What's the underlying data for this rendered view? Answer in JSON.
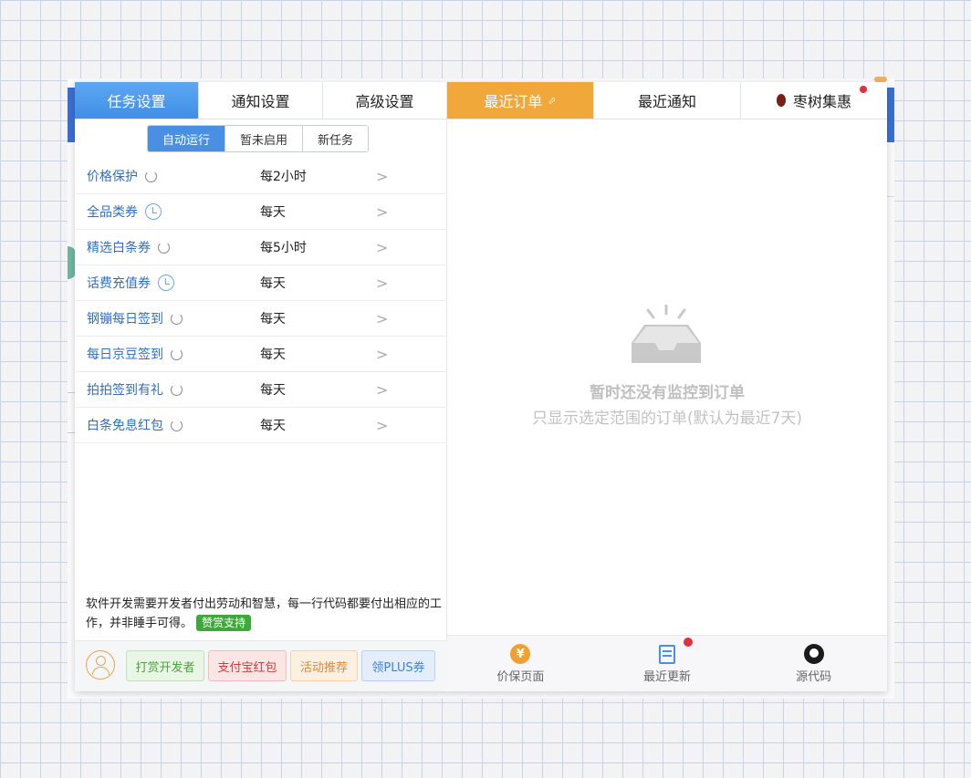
{
  "tabs_left": [
    {
      "label": "任务设置",
      "active": true
    },
    {
      "label": "通知设置",
      "active": false
    },
    {
      "label": "高级设置",
      "active": false
    }
  ],
  "tabs_right": [
    {
      "label": "最近订单",
      "active": true,
      "icon": "external-link-icon"
    },
    {
      "label": "最近通知",
      "active": false
    },
    {
      "label": "枣树集惠",
      "active": false,
      "icon": "jujube-icon"
    }
  ],
  "segments": [
    {
      "label": "自动运行",
      "active": true
    },
    {
      "label": "暂未启用",
      "active": false
    },
    {
      "label": "新任务",
      "active": false
    }
  ],
  "tasks": [
    {
      "name": "价格保护",
      "icon": "refresh-icon",
      "freq": "每2小时"
    },
    {
      "name": "全品类券",
      "icon": "clock-icon",
      "freq": "每天"
    },
    {
      "name": "精选白条券",
      "icon": "refresh-icon",
      "freq": "每5小时"
    },
    {
      "name": "话费充值券",
      "icon": "clock-icon",
      "freq": "每天"
    },
    {
      "name": "钢镚每日签到",
      "icon": "refresh-icon",
      "freq": "每天"
    },
    {
      "name": "每日京豆签到",
      "icon": "refresh-icon",
      "freq": "每天"
    },
    {
      "name": "拍拍签到有礼",
      "icon": "refresh-icon",
      "freq": "每天"
    },
    {
      "name": "白条免息红包",
      "icon": "refresh-icon",
      "freq": "每天"
    }
  ],
  "note": {
    "text": "软件开发需要开发者付出劳动和智慧，每一行代码都要付出相应的工作，并非睡手可得。",
    "button": "赞赏支持"
  },
  "bottom_left_buttons": [
    "打赏开发者",
    "支付宝红包",
    "活动推荐",
    "领PLUS券"
  ],
  "empty": {
    "title": "暂时还没有监控到订单",
    "subtitle": "只显示选定范围的订单(默认为最近7天)"
  },
  "bottom_nav": [
    {
      "label": "价保页面",
      "icon": "yen-icon"
    },
    {
      "label": "最近更新",
      "icon": "document-icon",
      "badge": true
    },
    {
      "label": "源代码",
      "icon": "github-icon"
    }
  ],
  "colors": {
    "accent_blue": "#4a90e2",
    "accent_orange": "#f0a83a",
    "link_blue": "#2f6fc4",
    "badge_red": "#e0303a"
  }
}
